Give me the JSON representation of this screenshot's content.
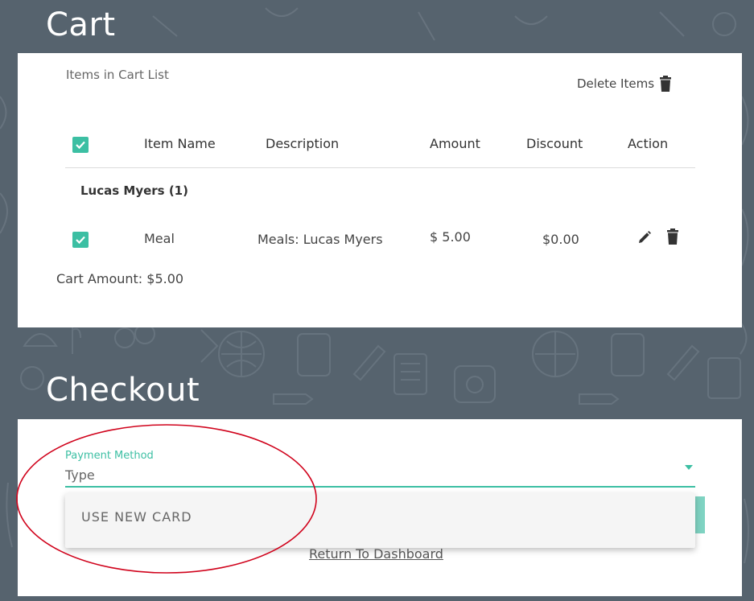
{
  "cart": {
    "title": "Cart",
    "list_caption": "Items in Cart List",
    "delete_items_label": "Delete Items",
    "columns": [
      "Item Name",
      "Description",
      "Amount",
      "Discount",
      "Action"
    ],
    "groups": [
      {
        "name": "Lucas Myers (1)",
        "rows": [
          {
            "checked": true,
            "item_name": "Meal",
            "description": "Meals: Lucas Myers",
            "amount": "$ 5.00",
            "discount": "$0.00"
          }
        ]
      }
    ],
    "cart_amount": "Cart Amount: $5.00"
  },
  "checkout": {
    "title": "Checkout",
    "payment_method_label": "Payment Method",
    "payment_method_value": "Type",
    "dropdown_options": [
      "USE NEW CARD"
    ],
    "return_link": "Return To Dashboard"
  },
  "colors": {
    "accent": "#3cbfa3",
    "background": "#56636e",
    "annotation": "#d0021b"
  }
}
